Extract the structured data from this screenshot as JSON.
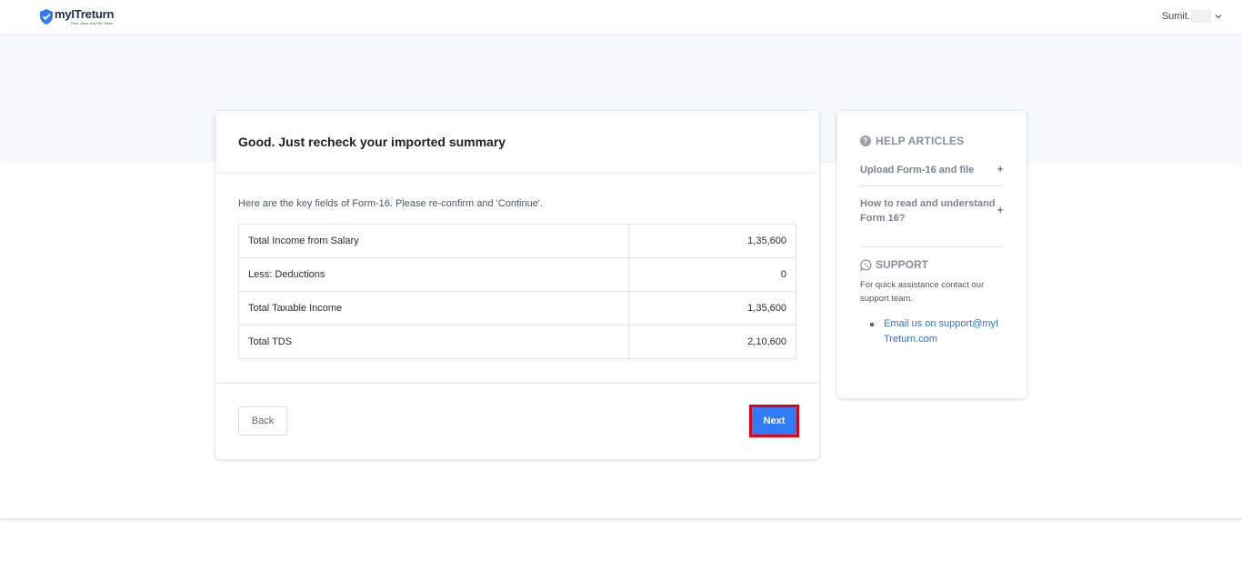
{
  "header": {
    "logo_text": "myITreturn",
    "logo_tagline": "Plan, Save and File Taxes",
    "user_name": "Sumit."
  },
  "main": {
    "title": "Good. Just recheck your imported summary",
    "intro": "Here are the key fields of Form-16. Please re-confirm and 'Continue'.",
    "rows": [
      {
        "label": "Total Income from Salary",
        "value": "1,35,600"
      },
      {
        "label": "Less: Deductions",
        "value": "0"
      },
      {
        "label": "Total Taxable Income",
        "value": "1,35,600"
      },
      {
        "label": "Total TDS",
        "value": "2,10,600"
      }
    ],
    "back_label": "Back",
    "next_label": "Next"
  },
  "side": {
    "help_title": "HELP ARTICLES",
    "articles": [
      {
        "label": "Upload Form-16 and file"
      },
      {
        "label": "How to read and understand Form 16?"
      }
    ],
    "support_title": "SUPPORT",
    "support_text": "For quick assistance contact our support team.",
    "email_link": "Email us on support@myITreturn.com"
  },
  "colors": {
    "primary": "#2f7bf5",
    "highlight": "#e00012",
    "hero_bg": "#f5f8fe"
  },
  "icons": [
    "shield-check-icon",
    "chevron-down-icon",
    "question-icon",
    "plus-icon",
    "whatsapp-icon"
  ]
}
